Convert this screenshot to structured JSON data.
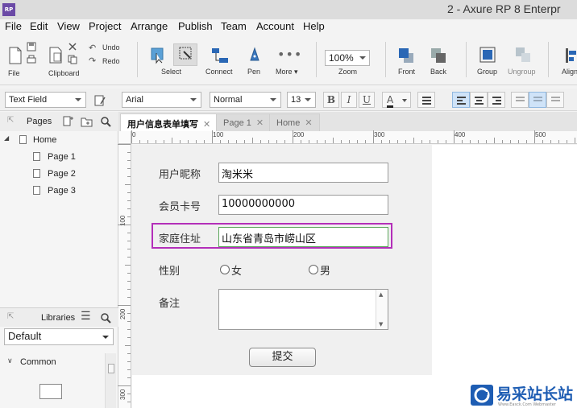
{
  "window": {
    "title": "2 - Axure RP 8 Enterpr",
    "logo": "RP"
  },
  "menu": [
    "File",
    "Edit",
    "View",
    "Project",
    "Arrange",
    "Publish",
    "Team",
    "Account",
    "Help"
  ],
  "toolbar": {
    "file": "File",
    "clipboard": "Clipboard",
    "undo": "Undo",
    "redo": "Redo",
    "select": "Select",
    "connect": "Connect",
    "pen": "Pen",
    "more": "More ▾",
    "zoom_value": "100%",
    "zoom": "Zoom",
    "front": "Front",
    "back": "Back",
    "group": "Group",
    "ungroup": "Ungroup",
    "align": "Align"
  },
  "stylebar": {
    "widget_type": "Text Field",
    "font": "Arial",
    "weight": "Normal",
    "size": "13",
    "bold": "B",
    "italic": "I",
    "underline": "U",
    "font_color_letter": "A"
  },
  "pages_panel": {
    "title": "Pages",
    "items": [
      "Home",
      "Page 1",
      "Page 2",
      "Page 3"
    ]
  },
  "libraries_panel": {
    "title": "Libraries",
    "selected_library": "Default",
    "group": "Common"
  },
  "tabs": [
    {
      "label": "用户信息表单填写",
      "active": true
    },
    {
      "label": "Page 1",
      "active": false
    },
    {
      "label": "Home",
      "active": false
    }
  ],
  "ruler": {
    "h_labels": [
      "0",
      "100",
      "200",
      "300",
      "400",
      "500"
    ],
    "v_labels": [
      "100",
      "200",
      "300"
    ]
  },
  "form": {
    "nickname_label": "用户昵称",
    "nickname_value": "淘米米",
    "card_label": "会员卡号",
    "card_value": "10000000000",
    "address_label": "家庭住址",
    "address_value": "山东省青岛市崂山区",
    "gender_label": "性别",
    "gender_female": "女",
    "gender_male": "男",
    "remark_label": "备注",
    "submit": "提交"
  },
  "watermark": {
    "text": "易采站长站",
    "url": "Www.Easck.Com  Webmaster"
  },
  "colors": {
    "highlight": "#b32fb9",
    "accent": "#1e5db3",
    "focus_border": "#5ba65b"
  }
}
